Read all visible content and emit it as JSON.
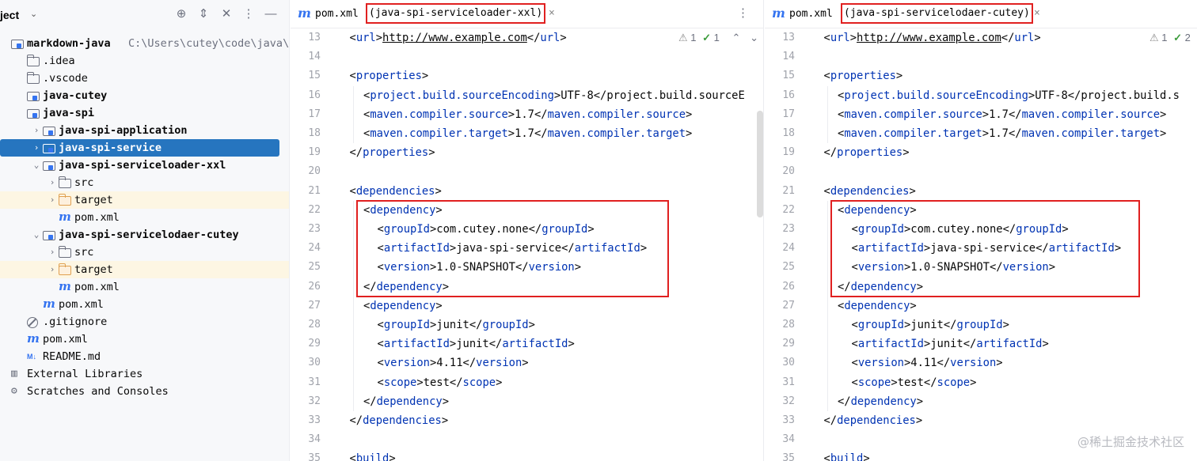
{
  "project": {
    "title": "ject",
    "header_icons": [
      "crosshair-icon",
      "expand-collapse-icon",
      "collapse-all-icon",
      "more-icon",
      "hide-icon"
    ],
    "tree": [
      {
        "label": "markdown-java",
        "path": "C:\\Users\\cutey\\code\\java\\markdo",
        "icon": "module-icon",
        "depth": 0,
        "arrow": "",
        "bold": true
      },
      {
        "label": ".idea",
        "icon": "folder-icon",
        "depth": 1,
        "arrow": ""
      },
      {
        "label": ".vscode",
        "icon": "folder-icon",
        "depth": 1,
        "arrow": ""
      },
      {
        "label": "java-cutey",
        "icon": "module-icon",
        "depth": 1,
        "arrow": "",
        "bold": true
      },
      {
        "label": "java-spi",
        "icon": "module-icon",
        "depth": 1,
        "arrow": "",
        "bold": true
      },
      {
        "label": "java-spi-application",
        "icon": "module-icon",
        "depth": 2,
        "arrow": "›",
        "bold": true
      },
      {
        "label": "java-spi-service",
        "icon": "module-icon",
        "depth": 2,
        "arrow": "›",
        "bold": true,
        "selected": true
      },
      {
        "label": "java-spi-serviceloader-xxl",
        "icon": "module-icon",
        "depth": 2,
        "arrow": "⌄",
        "bold": true
      },
      {
        "label": "src",
        "icon": "folder-icon",
        "depth": 3,
        "arrow": "›"
      },
      {
        "label": "target",
        "icon": "folder-orange-icon",
        "depth": 3,
        "arrow": "›",
        "target": true
      },
      {
        "label": "pom.xml",
        "icon": "maven-icon",
        "depth": 3,
        "arrow": ""
      },
      {
        "label": "java-spi-servicelodaer-cutey",
        "icon": "module-icon",
        "depth": 2,
        "arrow": "⌄",
        "bold": true
      },
      {
        "label": "src",
        "icon": "folder-icon",
        "depth": 3,
        "arrow": "›"
      },
      {
        "label": "target",
        "icon": "folder-orange-icon",
        "depth": 3,
        "arrow": "›",
        "target": true
      },
      {
        "label": "pom.xml",
        "icon": "maven-icon",
        "depth": 3,
        "arrow": ""
      },
      {
        "label": "pom.xml",
        "icon": "maven-icon",
        "depth": 2,
        "arrow": ""
      },
      {
        "label": ".gitignore",
        "icon": "ignore-icon",
        "depth": 1,
        "arrow": ""
      },
      {
        "label": "pom.xml",
        "icon": "maven-icon",
        "depth": 1,
        "arrow": ""
      },
      {
        "label": "README.md",
        "icon": "markdown-icon",
        "depth": 1,
        "arrow": ""
      },
      {
        "label": "External Libraries",
        "icon": "library-icon",
        "depth": 0,
        "arrow": ""
      },
      {
        "label": "Scratches and Consoles",
        "icon": "scratches-icon",
        "depth": 0,
        "arrow": ""
      }
    ]
  },
  "editors": [
    {
      "tab_name": "pom.xml",
      "tab_qualifier": "(java-spi-serviceloader-xxl)",
      "close_glyph": "×",
      "more_glyph": "⋮",
      "inspection": {
        "warnings": "1",
        "ok": "1"
      },
      "lines": [
        {
          "num": "13",
          "indent": 1,
          "text": "<url>http://www.example.com</url>"
        },
        {
          "num": "14",
          "indent": 0,
          "text": ""
        },
        {
          "num": "15",
          "indent": 1,
          "text": "<properties>"
        },
        {
          "num": "16",
          "indent": 2,
          "text": "<project.build.sourceEncoding>UTF-8</project.build.sourceE"
        },
        {
          "num": "17",
          "indent": 2,
          "text": "<maven.compiler.source>1.7</maven.compiler.source>"
        },
        {
          "num": "18",
          "indent": 2,
          "text": "<maven.compiler.target>1.7</maven.compiler.target>"
        },
        {
          "num": "19",
          "indent": 1,
          "text": "</properties>"
        },
        {
          "num": "20",
          "indent": 0,
          "text": ""
        },
        {
          "num": "21",
          "indent": 1,
          "text": "<dependencies>"
        },
        {
          "num": "22",
          "indent": 2,
          "text": "<dependency>"
        },
        {
          "num": "23",
          "indent": 3,
          "text": "<groupId>com.cutey.none</groupId>"
        },
        {
          "num": "24",
          "indent": 3,
          "text": "<artifactId>java-spi-service</artifactId>"
        },
        {
          "num": "25",
          "indent": 3,
          "text": "<version>1.0-SNAPSHOT</version>"
        },
        {
          "num": "26",
          "indent": 2,
          "text": "</dependency>"
        },
        {
          "num": "27",
          "indent": 2,
          "text": "<dependency>"
        },
        {
          "num": "28",
          "indent": 3,
          "text": "<groupId>junit</groupId>"
        },
        {
          "num": "29",
          "indent": 3,
          "text": "<artifactId>junit</artifactId>"
        },
        {
          "num": "30",
          "indent": 3,
          "text": "<version>4.11</version>"
        },
        {
          "num": "31",
          "indent": 3,
          "text": "<scope>test</scope>"
        },
        {
          "num": "32",
          "indent": 2,
          "text": "</dependency>"
        },
        {
          "num": "33",
          "indent": 1,
          "text": "</dependencies>"
        },
        {
          "num": "34",
          "indent": 0,
          "text": ""
        },
        {
          "num": "35",
          "indent": 1,
          "text": "<build>"
        }
      ]
    },
    {
      "tab_name": "pom.xml",
      "tab_qualifier": "(java-spi-servicelodaer-cutey)",
      "close_glyph": "×",
      "more_glyph": "",
      "inspection": {
        "warnings": "1",
        "ok": "2"
      },
      "lines": [
        {
          "num": "13",
          "indent": 1,
          "text": "<url>http://www.example.com</url>"
        },
        {
          "num": "14",
          "indent": 0,
          "text": ""
        },
        {
          "num": "15",
          "indent": 1,
          "text": "<properties>"
        },
        {
          "num": "16",
          "indent": 2,
          "text": "<project.build.sourceEncoding>UTF-8</project.build.s"
        },
        {
          "num": "17",
          "indent": 2,
          "text": "<maven.compiler.source>1.7</maven.compiler.source>"
        },
        {
          "num": "18",
          "indent": 2,
          "text": "<maven.compiler.target>1.7</maven.compiler.target>"
        },
        {
          "num": "19",
          "indent": 1,
          "text": "</properties>"
        },
        {
          "num": "20",
          "indent": 0,
          "text": ""
        },
        {
          "num": "21",
          "indent": 1,
          "text": "<dependencies>"
        },
        {
          "num": "22",
          "indent": 2,
          "text": "<dependency>"
        },
        {
          "num": "23",
          "indent": 3,
          "text": "<groupId>com.cutey.none</groupId>"
        },
        {
          "num": "24",
          "indent": 3,
          "text": "<artifactId>java-spi-service</artifactId>"
        },
        {
          "num": "25",
          "indent": 3,
          "text": "<version>1.0-SNAPSHOT</version>"
        },
        {
          "num": "26",
          "indent": 2,
          "text": "</dependency>"
        },
        {
          "num": "27",
          "indent": 2,
          "text": "<dependency>"
        },
        {
          "num": "28",
          "indent": 3,
          "text": "<groupId>junit</groupId>"
        },
        {
          "num": "29",
          "indent": 3,
          "text": "<artifactId>junit</artifactId>"
        },
        {
          "num": "30",
          "indent": 3,
          "text": "<version>4.11</version>"
        },
        {
          "num": "31",
          "indent": 3,
          "text": "<scope>test</scope>"
        },
        {
          "num": "32",
          "indent": 2,
          "text": "</dependency>"
        },
        {
          "num": "33",
          "indent": 1,
          "text": "</dependencies>"
        },
        {
          "num": "34",
          "indent": 0,
          "text": ""
        },
        {
          "num": "35",
          "indent": 1,
          "text": "<build>"
        }
      ]
    }
  ],
  "watermark": "@稀土掘金技术社区",
  "colors": {
    "selection": "#2675bf",
    "tag": "#0033b3",
    "annotation_box": "#e02020",
    "maven_icon": "#3574f0"
  }
}
